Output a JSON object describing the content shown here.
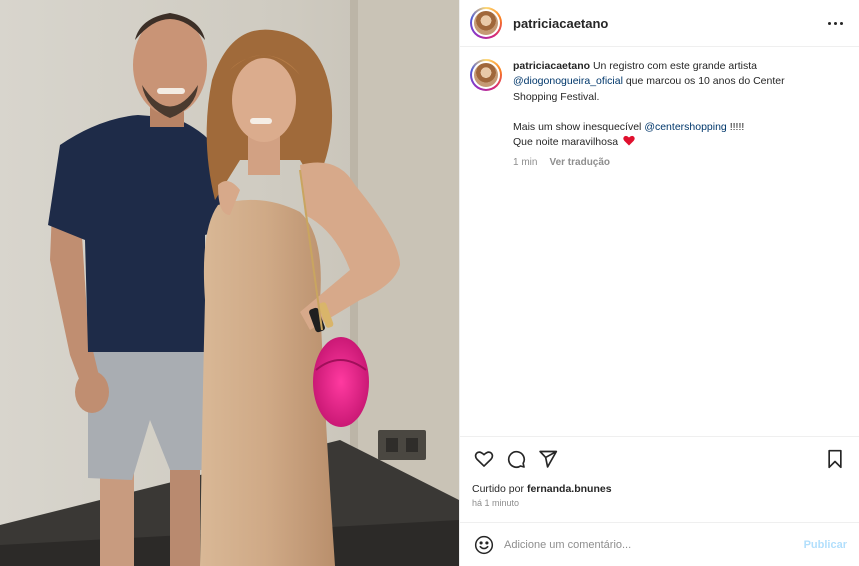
{
  "post": {
    "author": "patriciacaetano",
    "more_icon": "more-horizontal-icon"
  },
  "caption": {
    "author": "patriciacaetano",
    "text_1": "Un registro com este grande artista",
    "mention_1": "@diogonogueira_oficial",
    "text_2": "que marcou os 10 anos do Center Shopping Festival.",
    "text_3": "Mais um show inesquecível",
    "mention_2": "@centershopping",
    "text_4": "!!!!!",
    "text_5": "Que noite maravilhosa",
    "time": "1 min",
    "translate": "Ver tradução"
  },
  "actions": {
    "like_icon": "heart-icon",
    "comment_icon": "comment-icon",
    "share_icon": "share-icon",
    "save_icon": "bookmark-icon"
  },
  "likes": {
    "prefix": "Curtido por",
    "user": "fernanda.bnunes"
  },
  "posted_ago": "há 1 minuto",
  "comment": {
    "placeholder": "Adicione um comentário...",
    "publish": "Publicar"
  },
  "colors": {
    "mention": "#00376b",
    "muted": "#8e8e8e",
    "publish_disabled": "#b2dffc",
    "heart": "#ed4956"
  }
}
